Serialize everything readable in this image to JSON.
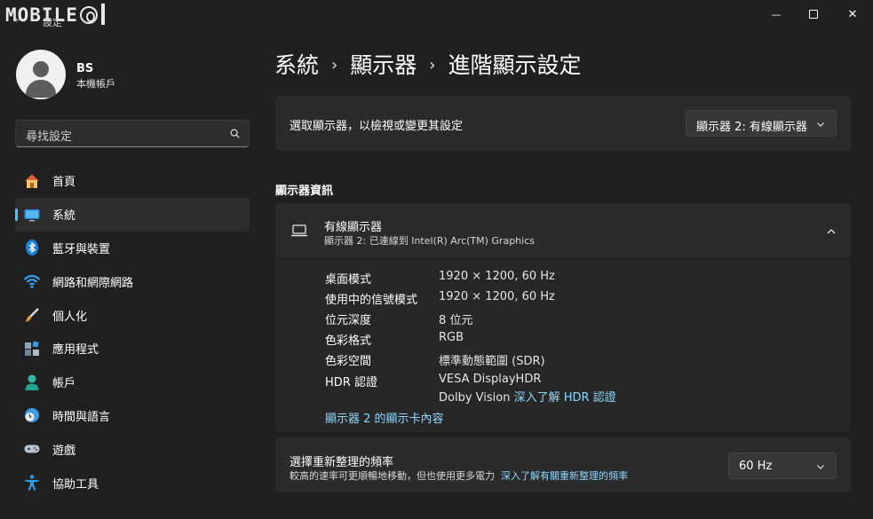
{
  "titlebar": {
    "logo_text": "MOBILE",
    "back_glyph": "←",
    "app_title": "設定",
    "minimize_glyph": "—",
    "close_glyph": "✕"
  },
  "account": {
    "name": "BS",
    "type": "本機帳戶"
  },
  "search": {
    "placeholder": "尋找設定"
  },
  "sidebar": {
    "items": [
      {
        "label": "首頁",
        "icon": "home-icon"
      },
      {
        "label": "系統",
        "icon": "system-display-icon",
        "active": true
      },
      {
        "label": "藍牙與裝置",
        "icon": "bluetooth-icon"
      },
      {
        "label": "網路和網際網路",
        "icon": "wifi-icon"
      },
      {
        "label": "個人化",
        "icon": "brush-icon"
      },
      {
        "label": "應用程式",
        "icon": "apps-icon"
      },
      {
        "label": "帳戶",
        "icon": "account-icon"
      },
      {
        "label": "時間與語言",
        "icon": "clock-globe-icon"
      },
      {
        "label": "遊戲",
        "icon": "gamepad-icon"
      },
      {
        "label": "協助工具",
        "icon": "accessibility-icon"
      }
    ]
  },
  "breadcrumb": {
    "items": [
      "系統",
      "顯示器",
      "進階顯示設定"
    ],
    "separator": "›"
  },
  "select_display": {
    "label": "選取顯示器，以檢視或變更其設定",
    "selected": "顯示器 2: 有線顯示器"
  },
  "section": {
    "title": "顯示器資訊"
  },
  "display_info": {
    "title": "有線顯示器",
    "subtitle": "顯示器 2: 已連線到 Intel(R) Arc(TM) Graphics",
    "rows": [
      {
        "key": "桌面模式",
        "value": "1920 × 1200, 60 Hz"
      },
      {
        "key": "使用中的信號模式",
        "value": "1920 × 1200, 60 Hz"
      },
      {
        "key": "位元深度",
        "value": "8 位元"
      },
      {
        "key": "色彩格式",
        "value": "RGB"
      },
      {
        "key": "色彩空間",
        "value": "標準動態範圍 (SDR)"
      },
      {
        "key": "HDR 認證",
        "value": "VESA DisplayHDR"
      }
    ],
    "hdr_line2": "Dolby Vision",
    "hdr_link": "深入了解 HDR 認證",
    "adapter_link": "顯示器 2 的顯示卡內容"
  },
  "refresh_rate": {
    "title": "選擇重新整理的頻率",
    "description": "較高的速率可更順暢地移動，但也使用更多電力",
    "link": "深入了解有關重新整理的頻率",
    "selected": "60 Hz"
  },
  "colors": {
    "background": "#202020",
    "card": "#2b2b2b",
    "accent": "#4cc2ff",
    "link": "#8ed8ff"
  }
}
